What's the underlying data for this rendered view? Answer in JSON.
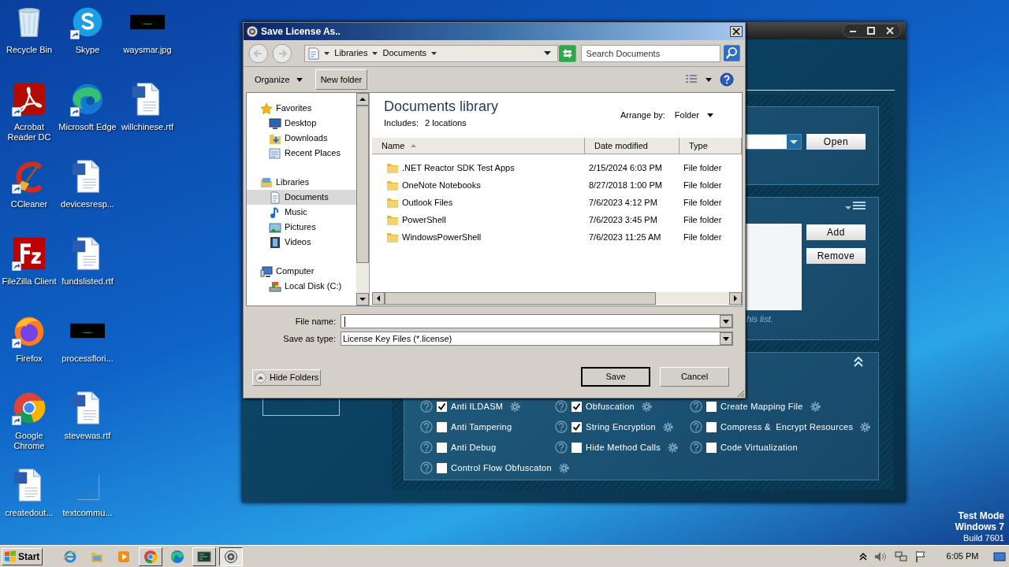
{
  "desktop_columns": [
    [
      {
        "label": "Recycle Bin",
        "kind": "recycle",
        "shortcut": false
      },
      {
        "label": "Acrobat Reader DC",
        "kind": "acrobat",
        "shortcut": true
      },
      {
        "label": "CCleaner",
        "kind": "ccleaner",
        "shortcut": true
      },
      {
        "label": "FileZilla Client",
        "kind": "filezilla",
        "shortcut": true
      },
      {
        "label": "Firefox",
        "kind": "firefox",
        "shortcut": true
      },
      {
        "label": "Google Chrome",
        "kind": "chrome",
        "shortcut": true
      },
      {
        "label": "createdout...",
        "kind": "word",
        "shortcut": false
      }
    ],
    [
      {
        "label": "Skype",
        "kind": "skype",
        "shortcut": true
      },
      {
        "label": "Microsoft Edge",
        "kind": "edge",
        "shortcut": true
      },
      {
        "label": "devicesresp...",
        "kind": "word",
        "shortcut": false
      },
      {
        "label": "fundslisted.rtf",
        "kind": "word",
        "shortcut": false
      },
      {
        "label": "processflori...",
        "kind": "image",
        "shortcut": false
      },
      {
        "label": "stevewas.rtf",
        "kind": "word",
        "shortcut": false
      },
      {
        "label": "textcommu...",
        "kind": "text",
        "shortcut": false
      }
    ],
    [
      {
        "label": "waysmar.jpg",
        "kind": "image",
        "shortcut": false
      },
      {
        "label": "willchinese.rtf",
        "kind": "word",
        "shortcut": false
      }
    ]
  ],
  "app_window": {
    "open_button": "Open",
    "list_buttons": [
      "Add",
      "Remove"
    ],
    "list_hint": "his list.",
    "option_columns": [
      [
        {
          "label": "Anti ILDASM",
          "checked": true,
          "settings": true
        },
        {
          "label": "Anti Tampering",
          "checked": false,
          "settings": false
        },
        {
          "label": "Anti Debug",
          "checked": false,
          "settings": false
        },
        {
          "label": "Control Flow Obfuscaton",
          "checked": false,
          "settings": true
        }
      ],
      [
        {
          "label": "Obfuscation",
          "checked": true,
          "settings": true
        },
        {
          "label": "String Encryption",
          "checked": true,
          "settings": true
        },
        {
          "label": "Hide Method Calls",
          "checked": false,
          "settings": true
        }
      ],
      [
        {
          "label": "Create Mapping File",
          "checked": false,
          "settings": true
        },
        {
          "label": "Compress &  Encrypt Resources",
          "checked": false,
          "settings": true
        },
        {
          "label": "Code Virtualization",
          "checked": false,
          "settings": false
        }
      ]
    ]
  },
  "dialog": {
    "title": "Save License As..",
    "breadcrumb": [
      "Libraries",
      "Documents"
    ],
    "search_placeholder": "Search Documents",
    "organize": "Organize",
    "new_folder": "New folder",
    "nav_tree": [
      {
        "label": "Favorites",
        "kind": "star",
        "selected": false,
        "children": [
          {
            "label": "Desktop",
            "kind": "desktop",
            "selected": false
          },
          {
            "label": "Downloads",
            "kind": "downloads",
            "selected": false
          },
          {
            "label": "Recent Places",
            "kind": "places",
            "selected": false
          }
        ]
      },
      {
        "label": "Libraries",
        "kind": "library",
        "selected": false,
        "children": [
          {
            "label": "Documents",
            "kind": "documents",
            "selected": true
          },
          {
            "label": "Music",
            "kind": "music",
            "selected": false
          },
          {
            "label": "Pictures",
            "kind": "pictures",
            "selected": false
          },
          {
            "label": "Videos",
            "kind": "videos",
            "selected": false
          }
        ]
      },
      {
        "label": "Computer",
        "kind": "computer",
        "selected": false,
        "children": [
          {
            "label": "Local Disk (C:)",
            "kind": "disk",
            "selected": false
          }
        ]
      }
    ],
    "library_title": "Documents library",
    "includes_label": "Includes:",
    "includes_value": "2 locations",
    "arrange_label": "Arrange by:",
    "arrange_value": "Folder",
    "columns": [
      "Name",
      "Date modified",
      "Type"
    ],
    "rows": [
      {
        "name": ".NET Reactor SDK Test Apps",
        "date": "2/15/2024 6:03 PM",
        "type": "File folder"
      },
      {
        "name": "OneNote Notebooks",
        "date": "8/27/2018 1:00 PM",
        "type": "File folder"
      },
      {
        "name": "Outlook Files",
        "date": "7/6/2023 4:12 PM",
        "type": "File folder"
      },
      {
        "name": "PowerShell",
        "date": "7/6/2023 3:45 PM",
        "type": "File folder"
      },
      {
        "name": "WindowsPowerShell",
        "date": "7/6/2023 11:25 AM",
        "type": "File folder"
      }
    ],
    "file_name_label": "File name:",
    "save_type_label": "Save as type:",
    "save_type_value": "License Key Files (*.license)",
    "hide_folders": "Hide Folders",
    "save": "Save",
    "cancel": "Cancel"
  },
  "system_watermark": [
    "Test Mode",
    "Windows 7",
    "Build 7601"
  ],
  "taskbar": {
    "start": "Start",
    "apps": [
      {
        "kind": "ie",
        "running": false,
        "selected": false
      },
      {
        "kind": "explorer",
        "running": false,
        "selected": false
      },
      {
        "kind": "media",
        "running": false,
        "selected": false
      },
      {
        "kind": "chrome",
        "running": true,
        "selected": false
      },
      {
        "kind": "edge",
        "running": false,
        "selected": false
      },
      {
        "kind": "terminal",
        "running": true,
        "selected": false
      },
      {
        "kind": "app",
        "running": true,
        "selected": true
      }
    ],
    "time": "6:05 PM"
  }
}
